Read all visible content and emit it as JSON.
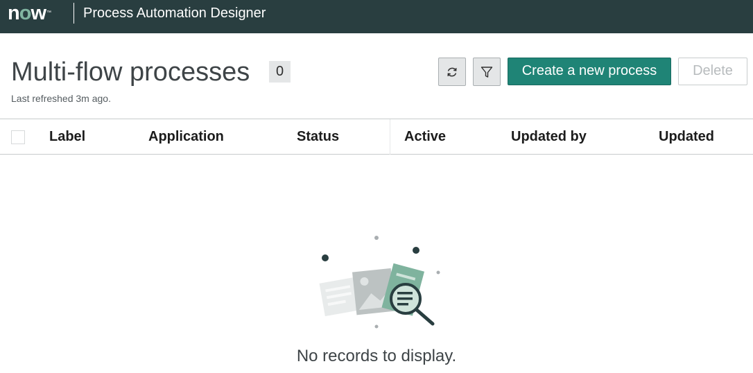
{
  "topbar": {
    "logo_text": "now",
    "app_title": "Process Automation Designer"
  },
  "header": {
    "title": "Multi-flow processes",
    "count": "0",
    "last_refreshed": "Last refreshed 3m ago."
  },
  "toolbar": {
    "refresh_icon": "refresh-icon",
    "filter_icon": "filter-icon",
    "create_label": "Create a new process",
    "delete_label": "Delete"
  },
  "table": {
    "columns": [
      "Label",
      "Application",
      "Status",
      "Active",
      "Updated by",
      "Updated"
    ]
  },
  "empty_state": {
    "icon": "empty-search-illustration",
    "message": "No records to display."
  },
  "colors": {
    "topbar": "#293e40",
    "primary": "#1f8476",
    "accent": "#81b5a1"
  }
}
